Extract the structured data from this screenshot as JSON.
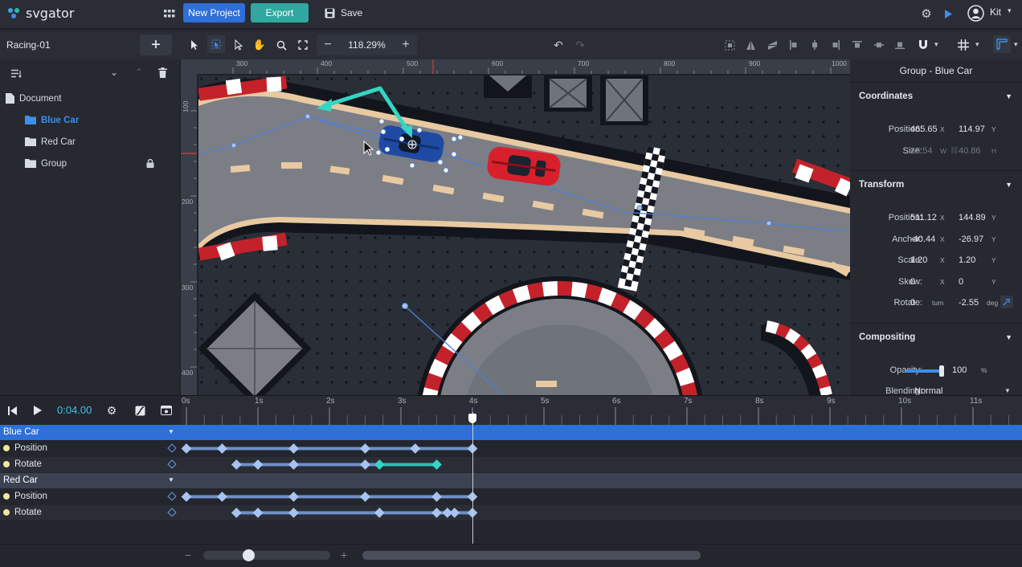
{
  "app": {
    "brand": "svgator",
    "user": "Kit"
  },
  "topbar": {
    "new_project_label": "New Project",
    "export_label": "Export",
    "save_label": "Save"
  },
  "project": {
    "name": "Racing-01"
  },
  "toolbar": {
    "zoom": "118.29%"
  },
  "ruler": {
    "h_ticks": [
      "300",
      "400",
      "500",
      "600",
      "700",
      "800",
      "900",
      "1000"
    ],
    "v_ticks": [
      "100",
      "200",
      "300",
      "400"
    ]
  },
  "layers": {
    "items": [
      {
        "label": "Document",
        "icon": "document-icon"
      },
      {
        "label": "Blue Car",
        "icon": "folder-icon",
        "selected": true
      },
      {
        "label": "Red Car",
        "icon": "folder-icon"
      },
      {
        "label": "Group",
        "icon": "folder-icon",
        "locked": true
      }
    ]
  },
  "inspector": {
    "title": "Group - Blue Car",
    "coordinates": {
      "title": "Coordinates",
      "position_label": "Position:",
      "pos_x": "465.65",
      "pos_y": "114.97",
      "size_label": "Size:",
      "w": "83.54",
      "h": "40.86"
    },
    "transform": {
      "title": "Transform",
      "position_label": "Position:",
      "pos_x": "511.12",
      "pos_y": "144.89",
      "anchor_label": "Anchor:",
      "anchor_x": "-40.44",
      "anchor_y": "-26.97",
      "scale_label": "Scale:",
      "scale_x": "1.20",
      "scale_y": "1.20",
      "skew_label": "Skew:",
      "skew_x": "0",
      "skew_y": "0",
      "rotate_label": "Rotate:",
      "rotate_turn": "0",
      "rotate_deg": "-2.55"
    },
    "compositing": {
      "title": "Compositing",
      "opacity_label": "Opacity:",
      "opacity": "100",
      "opacity_fraction": 1.0,
      "blending_label": "Blending:",
      "blending": "Normal"
    },
    "units": {
      "x": "X",
      "y": "Y",
      "w": "W",
      "h": "H",
      "turn": "turn",
      "deg": "deg",
      "pct": "%"
    }
  },
  "timeline": {
    "time": "0:04.00",
    "playhead_seconds": 4,
    "seconds_labels": [
      "0s",
      "1s",
      "2s",
      "3s",
      "4s",
      "5s",
      "6s",
      "7s",
      "8s",
      "9s",
      "10s",
      "11s"
    ],
    "groups": [
      {
        "name": "Blue Car",
        "tracks": [
          {
            "name": "Position",
            "keys": [
              0,
              0.5,
              1.5,
              2.5,
              3.2,
              4.0
            ]
          },
          {
            "name": "Rotate",
            "keys": [
              0.7,
              1.0,
              1.5,
              2.5,
              2.7,
              3.5
            ]
          }
        ]
      },
      {
        "name": "Red Car",
        "tracks": [
          {
            "name": "Position",
            "keys": [
              0,
              0.5,
              1.5,
              2.5,
              3.5,
              4.0
            ]
          },
          {
            "name": "Rotate",
            "keys": [
              0.7,
              1.0,
              1.5,
              2.7,
              3.5,
              3.65,
              3.75,
              4.0
            ]
          }
        ]
      }
    ]
  },
  "colors": {
    "accent": "#3d8ef0",
    "teal": "#2fbdb0",
    "new_project": "#2e6fd8",
    "export": "#2fa8a0",
    "key": "#a9c3ee",
    "key_active": "#33d6c4"
  }
}
